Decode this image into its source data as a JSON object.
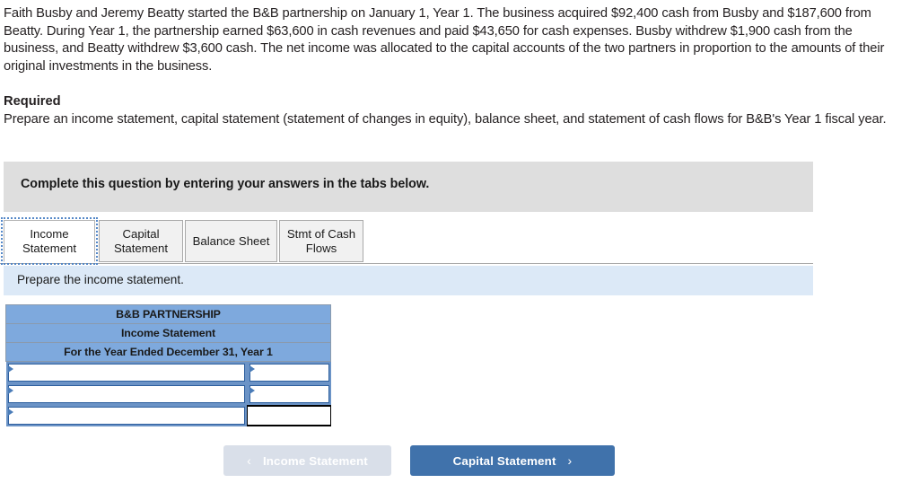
{
  "problem": {
    "paragraph": "Faith Busby and Jeremy Beatty started the B&B partnership on January 1, Year 1. The business acquired $92,400 cash from Busby and $187,600 from Beatty. During Year 1, the partnership earned $63,600 in cash revenues and paid $43,650 for cash expenses. Busby withdrew $1,900 cash from the business, and Beatty withdrew $3,600 cash. The net income was allocated to the capital accounts of the two partners in proportion to the amounts of their original investments in the business.",
    "required_heading": "Required",
    "required_text": "Prepare an income statement, capital statement (statement of changes in equity), balance sheet, and statement of cash flows for B&B's Year 1 fiscal year."
  },
  "instruction_banner": {
    "text": "Complete this question by entering your answers in the tabs below."
  },
  "tabs": [
    {
      "label_line1": "Income",
      "label_line2": "Statement",
      "active": true
    },
    {
      "label_line1": "Capital",
      "label_line2": "Statement",
      "active": false
    },
    {
      "label_line1": "Balance Sheet",
      "label_line2": "",
      "active": false
    },
    {
      "label_line1": "Stmt of Cash",
      "label_line2": "Flows",
      "active": false
    }
  ],
  "subinstruction": {
    "text": "Prepare the income statement."
  },
  "worksheet": {
    "header_rows": [
      "B&B PARTNERSHIP",
      "Income Statement",
      "For the Year Ended December 31, Year 1"
    ],
    "entry_rows": [
      {
        "label_value": "",
        "label_placeholder": "",
        "amount_value": "",
        "amount_placeholder": "",
        "amount_style": "input"
      },
      {
        "label_value": "",
        "label_placeholder": "",
        "amount_value": "",
        "amount_placeholder": "",
        "amount_style": "input"
      },
      {
        "label_value": "",
        "label_placeholder": "",
        "amount_value": "",
        "amount_placeholder": "",
        "amount_style": "total"
      }
    ]
  },
  "navigation": {
    "prev_label": "Income Statement",
    "prev_chevron": "‹",
    "prev_disabled": true,
    "next_label": "Capital Statement",
    "next_chevron": "›"
  },
  "colors": {
    "banner_gray": "#dedede",
    "subinstruction_blue": "#dce9f7",
    "table_header_blue": "#7ea9dd",
    "cell_frame_blue": "#6b93c6",
    "nav_next_blue": "#4072ab",
    "nav_prev_disabled": "#d9dfe9"
  }
}
